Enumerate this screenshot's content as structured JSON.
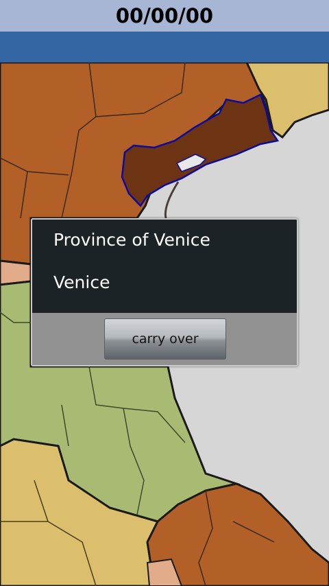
{
  "header": {
    "date": "00/00/00"
  },
  "dialog": {
    "line1": "Province of Venice",
    "line2": "Venice",
    "button_label": "carry over"
  },
  "colors": {
    "header_bg": "#a8b6d6",
    "blue_bar": "#3366a3",
    "region_brown": "#b25f28",
    "region_dark_brown": "#6d3414",
    "region_green": "#a9bb72",
    "region_tan": "#dcbf6c",
    "sea": "#d6d6d6",
    "dialog_bg": "#1c2326",
    "dialog_footer": "#919191"
  }
}
